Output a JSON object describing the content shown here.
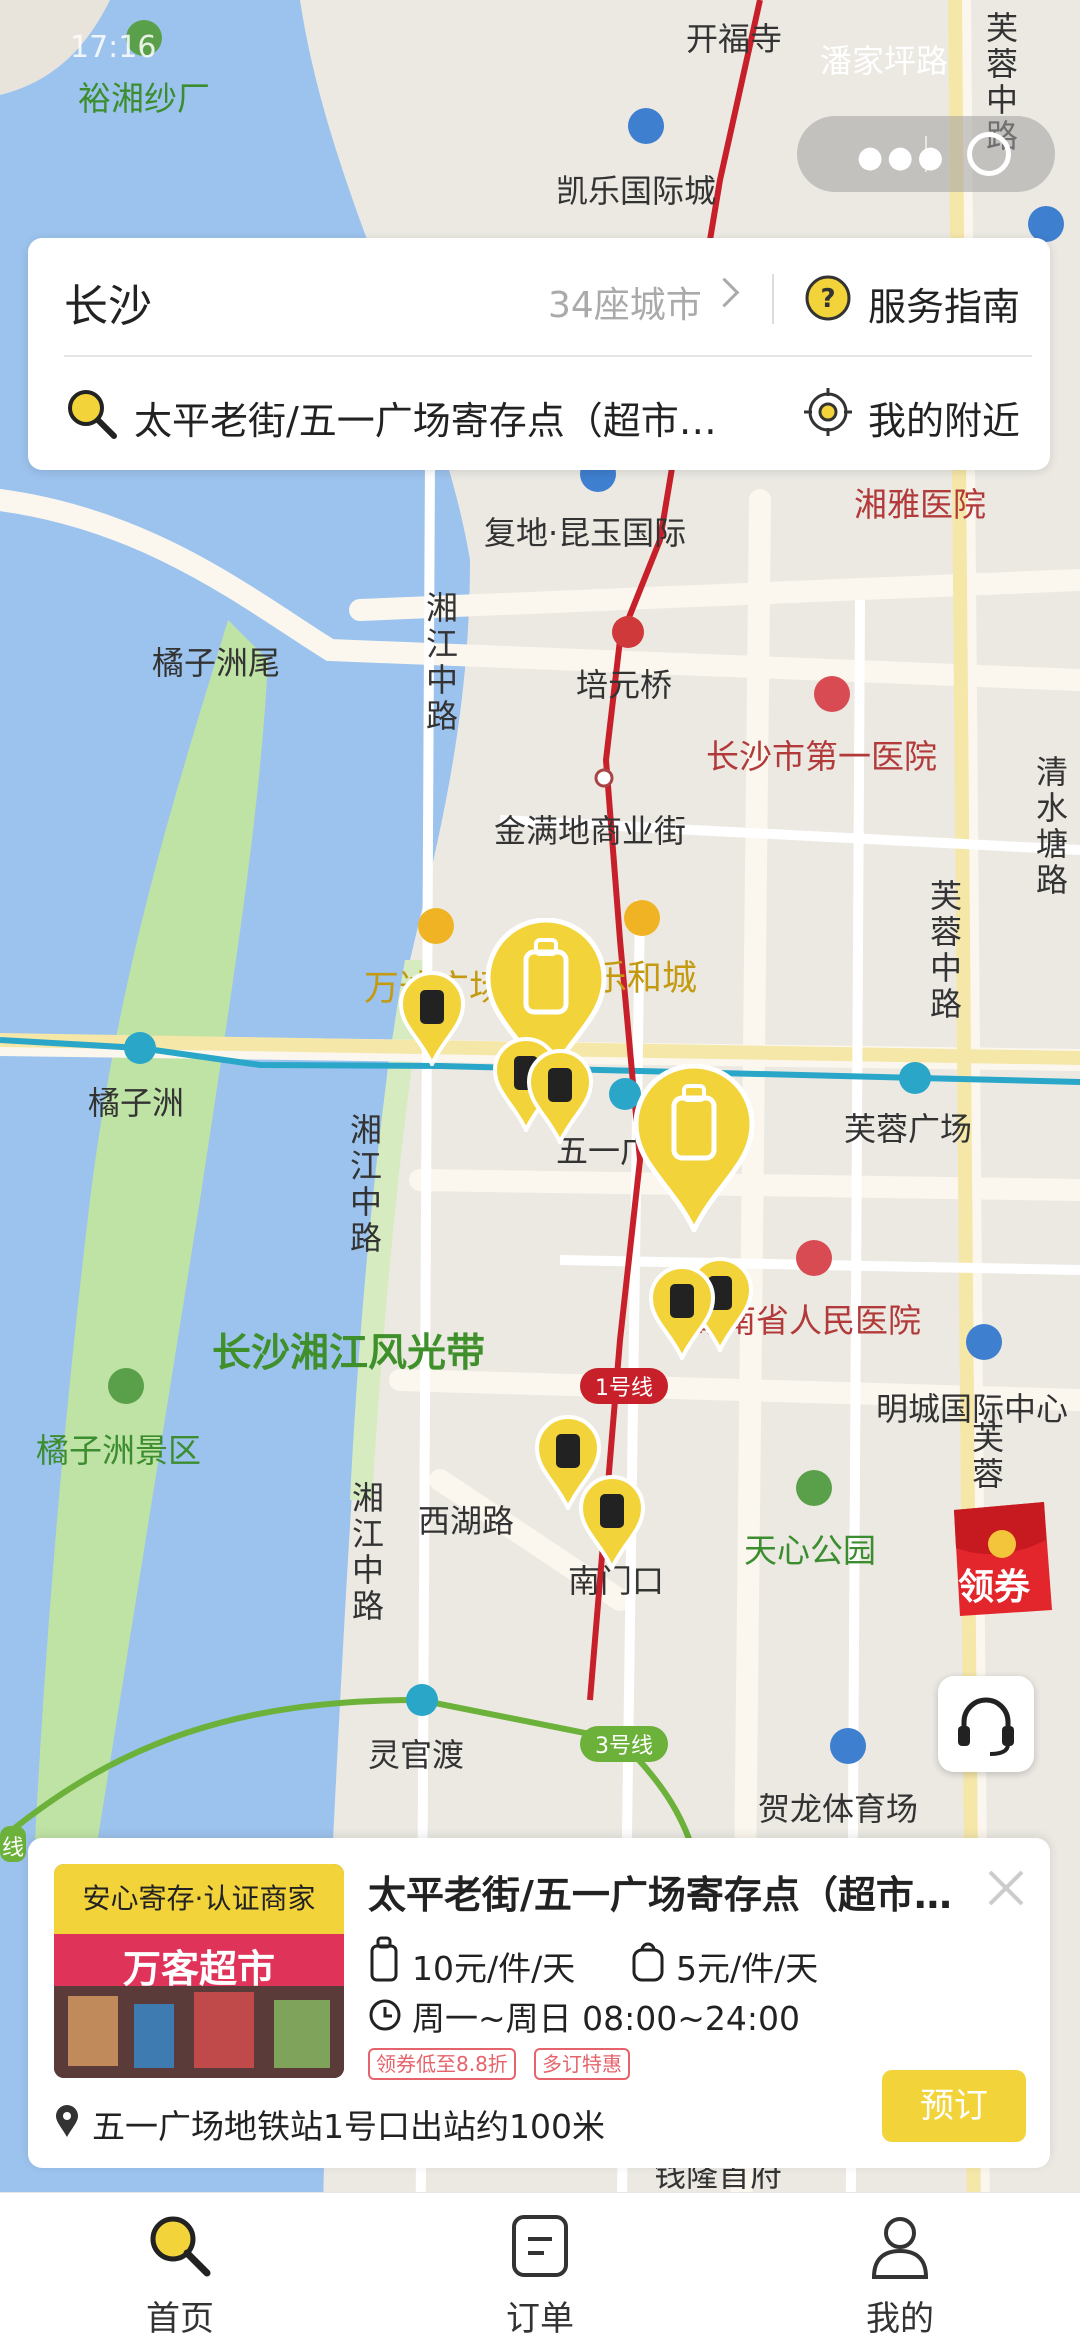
{
  "status_bar": {
    "time": "17:16"
  },
  "search_card": {
    "city": "长沙",
    "city_count": "34座城市",
    "guide_label": "服务指南",
    "search_text": "太平老街/五一广场寄存点（超市…",
    "nearby_label": "我的附近"
  },
  "map": {
    "labels": {
      "yuxiang": "裕湘纱厂",
      "kaifusi": "开福寺",
      "panjiaping": "潘家坪路",
      "kaile": "凯乐国际城",
      "furong_top": "芙蓉中路",
      "fudi": "复地·昆玉国际",
      "xiangya": "湘雅医院",
      "juzizhouwei": "橘子洲尾",
      "xiangjiang1": "湘江中路",
      "peiyuanqiao": "培元桥",
      "diyi_hospital": "长沙市第一医院",
      "qingshuitang": "清水塘路",
      "jinmandi": "金满地商业街",
      "furong_mid": "芙蓉中路",
      "wanda": "万达广场",
      "lehecheng": "乐和城",
      "juzizhou": "橘子洲",
      "wuyi": "五一广场",
      "furong_square": "芙蓉广场",
      "xiangjiang2": "湘江中路",
      "renmin_hospital": "湖南省人民医院",
      "fengguangdai": "长沙湘江风光带",
      "mingcheng": "明城国际中心",
      "line1": "1号线",
      "juzizhou_scenic": "橘子洲景区",
      "xihu": "西湖路",
      "furong_low": "芙蓉",
      "tianxin": "天心公园",
      "xiangjiang3": "湘江中路",
      "nanmenkou": "南门口",
      "lingguandu": "灵官渡",
      "line3": "3号线",
      "helong": "贺龙体育场",
      "line_edge": "线",
      "qianlong": "钱隆首府"
    }
  },
  "coupon": {
    "label": "领券"
  },
  "shop": {
    "badge": "安心寄存·认证商家",
    "store_sign": "万客超市",
    "title": "太平老街/五一广场寄存点（超市…",
    "price_large": "10元/件/天",
    "price_small": "5元/件/天",
    "hours": "周一~周日 08:00~24:00",
    "tags": [
      "领券低至8.8折",
      "多订特惠"
    ],
    "address": "五一广场地铁站1号口出站约100米",
    "book_label": "预订"
  },
  "tabbar": {
    "home": "首页",
    "orders": "订单",
    "mine": "我的"
  },
  "colors": {
    "brand_yellow": "#f3d33a",
    "metro_red": "#c8202a",
    "metro_blue": "#2aa6c9",
    "metro_green": "#6bb13a",
    "water": "#9cc3ee",
    "park_green": "#bfe3a5"
  }
}
